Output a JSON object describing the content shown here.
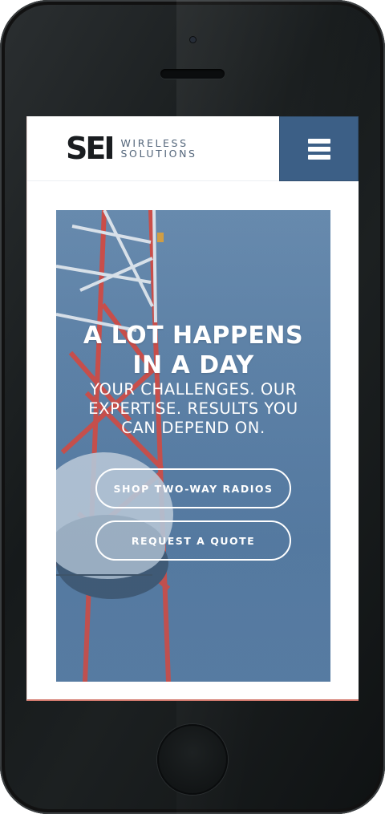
{
  "logo": {
    "mark": "SEI",
    "line1": "WIRELESS",
    "line2": "SOLUTIONS"
  },
  "header": {
    "menu_icon": "hamburger-menu-icon"
  },
  "hero": {
    "title_line1": "A LOT HAPPENS",
    "title_line2": "IN A DAY",
    "subtitle_line1": "YOUR CHALLENGES. OUR",
    "subtitle_line2": "EXPERTISE. RESULTS YOU",
    "subtitle_line3": "CAN DEPEND ON.",
    "cta_shop": "SHOP TWO-WAY RADIOS",
    "cta_quote": "REQUEST A QUOTE"
  },
  "colors": {
    "brand_blue": "#3c5f86",
    "sky": "#6b8db0",
    "tower_red": "#c73b32"
  }
}
